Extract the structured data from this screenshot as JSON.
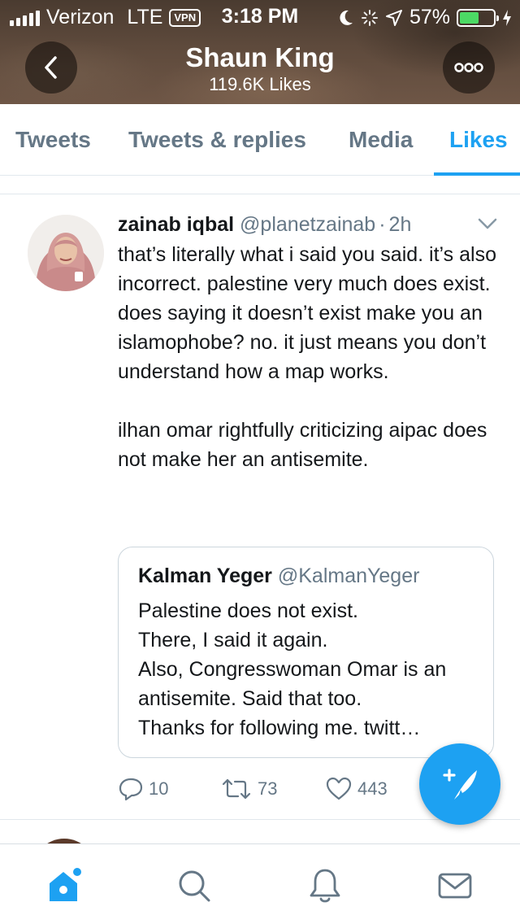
{
  "status_bar": {
    "carrier": "Verizon",
    "network": "LTE",
    "vpn": "VPN",
    "time": "3:18 PM",
    "battery_percent": "57%",
    "battery_level": 0.57
  },
  "header": {
    "name": "Shaun King",
    "likes_count": "119.6K Likes",
    "back_icon": "chevron-left-icon",
    "more_icon": "ellipsis-icon"
  },
  "tabs": [
    {
      "label": "Tweets",
      "active": false
    },
    {
      "label": "Tweets & replies",
      "active": false
    },
    {
      "label": "Media",
      "active": false
    },
    {
      "label": "Likes",
      "active": true
    }
  ],
  "tweet": {
    "author_name": "zainab iqbal",
    "author_handle": "@planetzainab",
    "separator": "·",
    "time": "2h",
    "text": "that’s literally what i said you said. it’s also incorrect. palestine very much does exist. does saying it doesn’t exist make you an islamophobe? no. it just means you don’t understand how a map works.\n\nilhan omar rightfully criticizing aipac does not make her an antisemite.",
    "quote": {
      "author_name": "Kalman Yeger",
      "author_handle": "@KalmanYeger",
      "text": "Palestine does not exist.\nThere, I said it again.\nAlso, Congresswoman Omar is an antisemite.  Said that too.\nThanks for following me. twitt…"
    },
    "actions": {
      "replies": "10",
      "retweets": "73",
      "likes": "443"
    }
  },
  "bottom_nav": [
    "home-icon",
    "search-icon",
    "notifications-icon",
    "messages-icon"
  ],
  "colors": {
    "accent": "#1da1f2",
    "secondary_text": "#657786",
    "border": "#e1e8ed"
  }
}
